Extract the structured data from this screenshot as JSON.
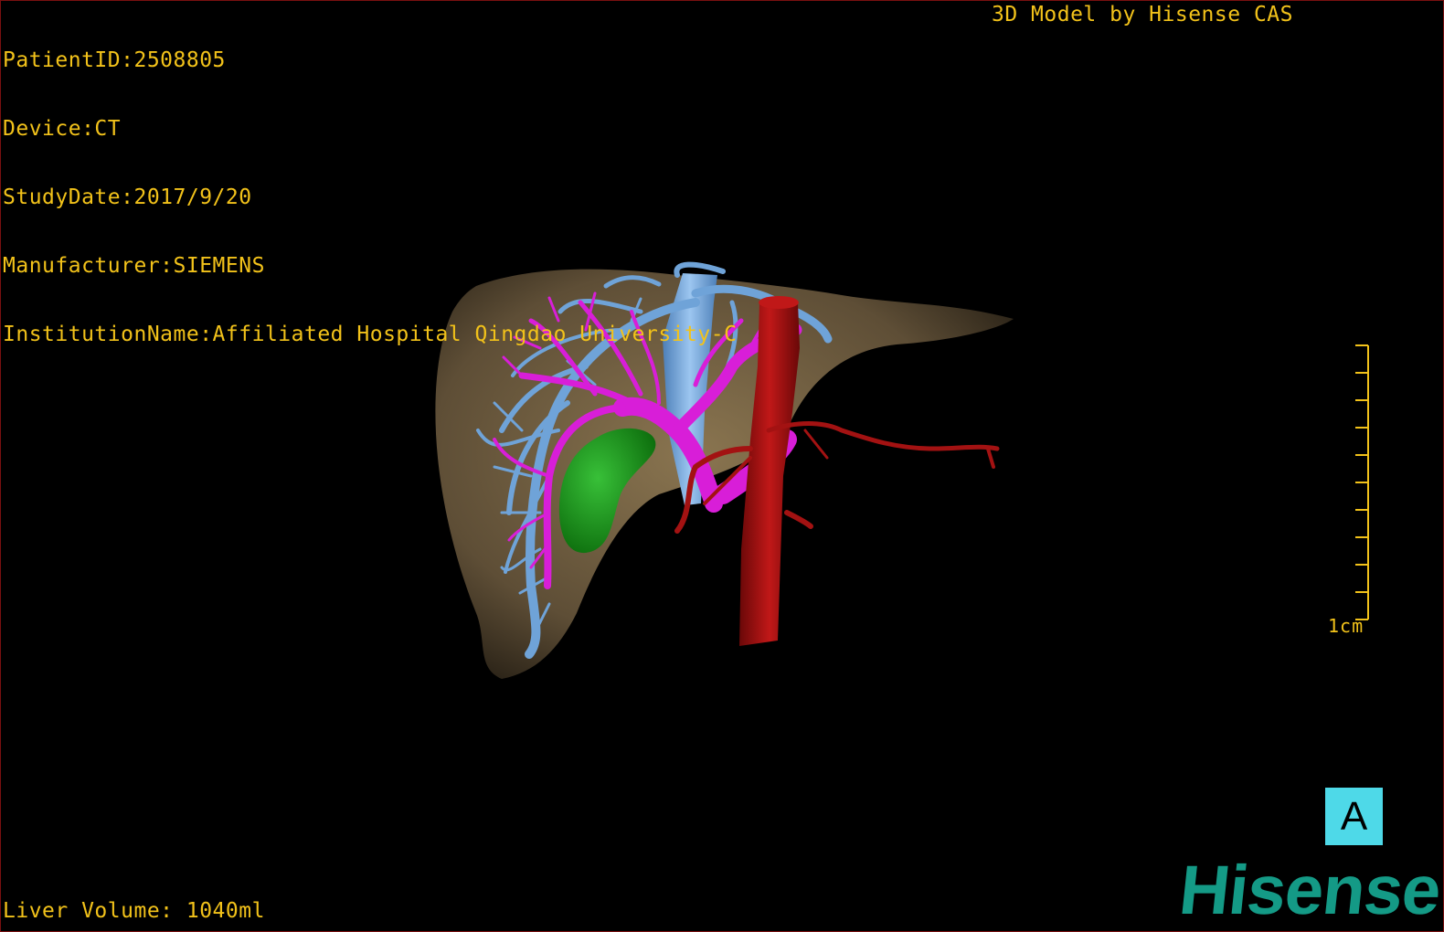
{
  "overlay": {
    "patient_id": "PatientID:2508805",
    "device": "Device:CT",
    "study_date": "StudyDate:2017/9/20",
    "manufacturer": "Manufacturer:SIEMENS",
    "institution": "InstitutionName:Affiliated Hospital Qingdao University-C",
    "model_credit": "3D Model by Hisense CAS",
    "liver_volume": "Liver Volume: 1040ml"
  },
  "scale_bar": {
    "label": "1cm"
  },
  "orientation": {
    "label": "A"
  },
  "logo": {
    "text": "Hisense"
  },
  "colors": {
    "overlay_text": "#f2c21a",
    "liver": "#6b5a40",
    "hepatic_vein": "#6fa3d8",
    "portal_vein": "#d81ed8",
    "artery": "#a31212",
    "gallbladder": "#18a018",
    "orientation_box": "#4ed9e8",
    "logo": "#149a86"
  }
}
